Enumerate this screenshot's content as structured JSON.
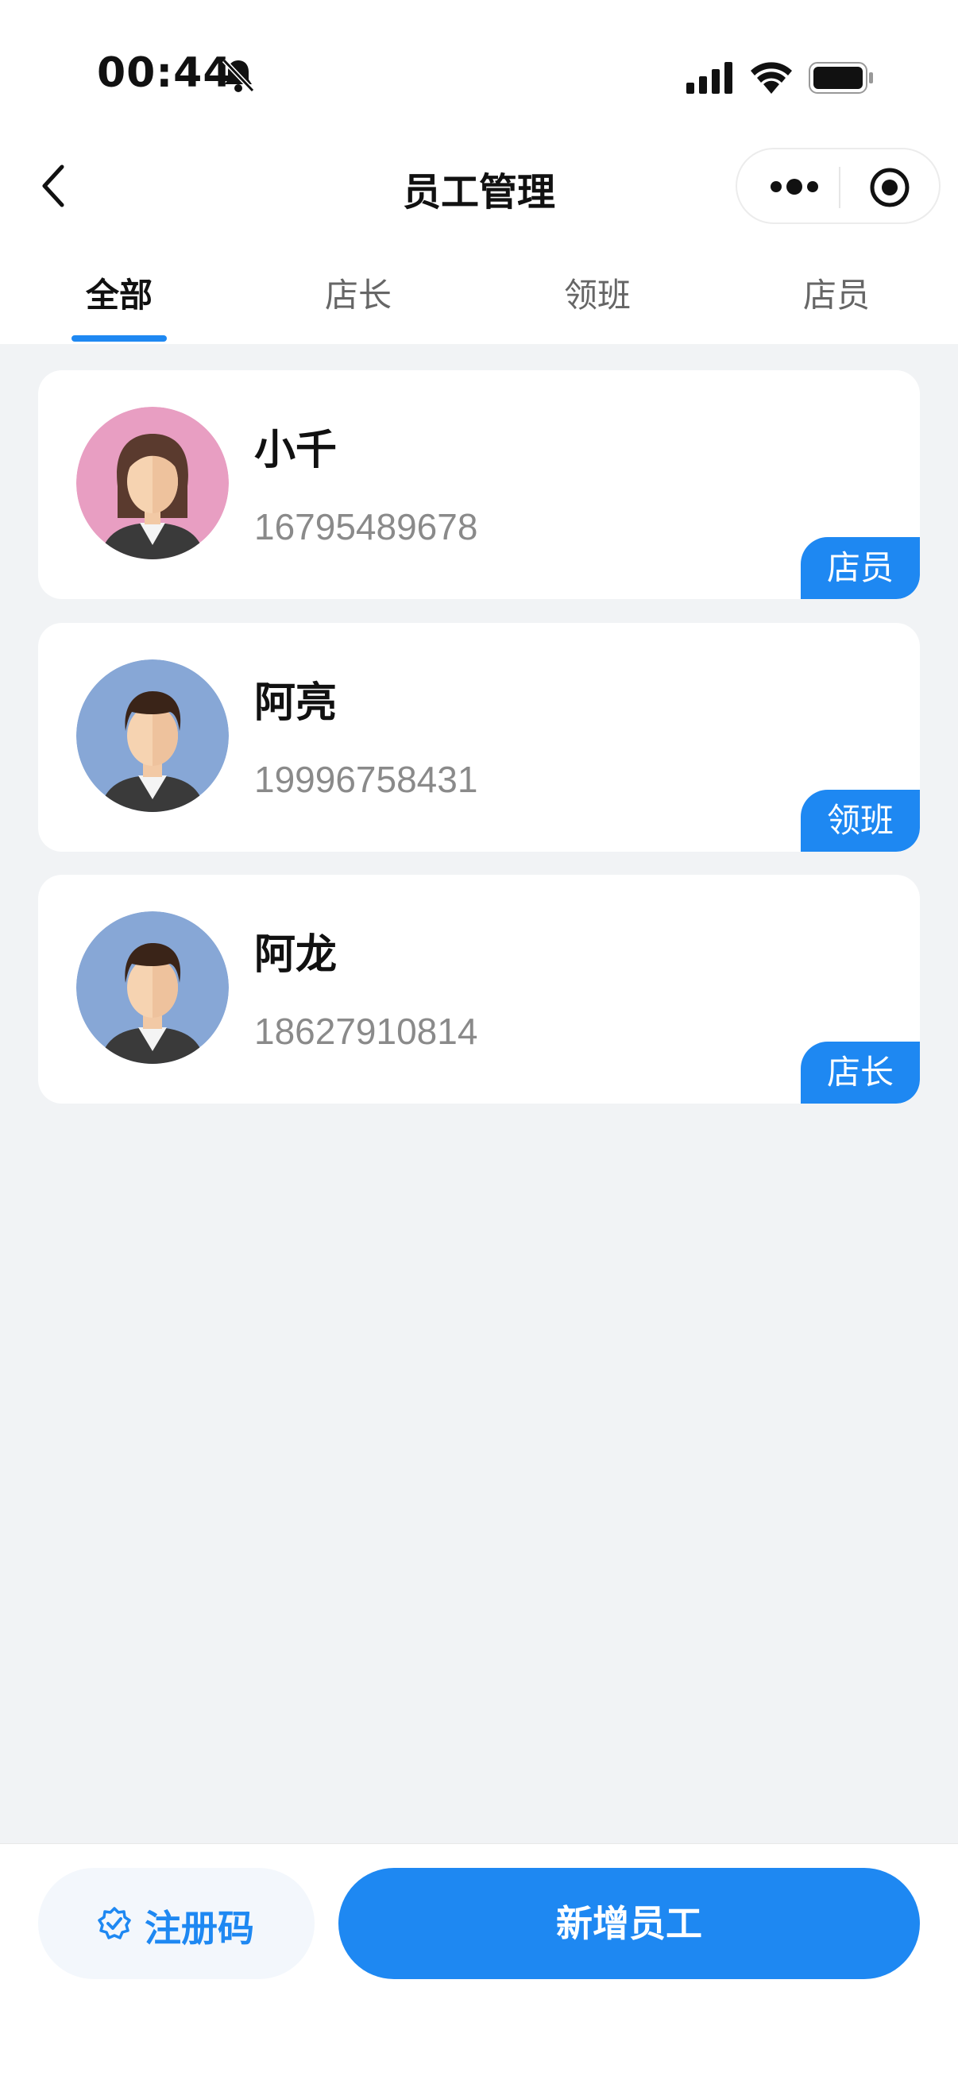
{
  "status_bar": {
    "time": "00:44"
  },
  "nav": {
    "title": "员工管理"
  },
  "tabs": [
    {
      "label": "全部",
      "active": true
    },
    {
      "label": "店长",
      "active": false
    },
    {
      "label": "领班",
      "active": false
    },
    {
      "label": "店员",
      "active": false
    }
  ],
  "employees": [
    {
      "name": "小千",
      "phone": "16795489678",
      "role": "店员",
      "avatar": "female-avatar"
    },
    {
      "name": "阿亮",
      "phone": "19996758431",
      "role": "领班",
      "avatar": "male-avatar"
    },
    {
      "name": "阿龙",
      "phone": "18627910814",
      "role": "店长",
      "avatar": "male-avatar"
    }
  ],
  "bottom": {
    "register_code_label": "注册码",
    "add_employee_label": "新增员工"
  },
  "colors": {
    "accent": "#1e88f2",
    "background": "#f1f3f5",
    "female_avatar_bg": "#e89ec2",
    "male_avatar_bg": "#87a7d6"
  }
}
